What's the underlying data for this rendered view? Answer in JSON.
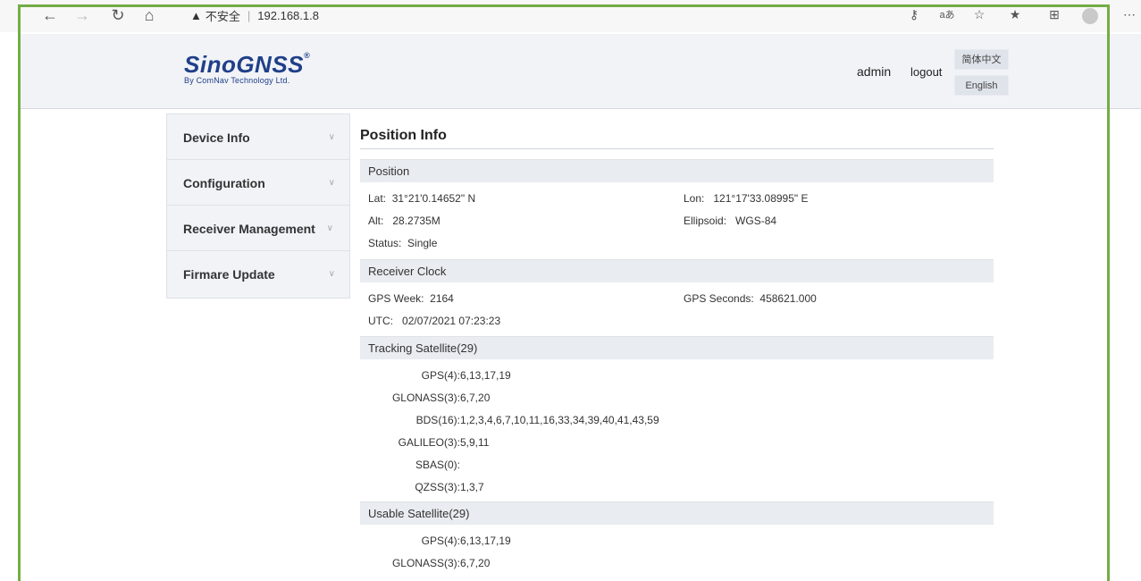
{
  "browser": {
    "security_label": "不安全",
    "url": "192.168.1.8"
  },
  "header": {
    "brand": "SinoGNSS",
    "brand_mark": "®",
    "brand_sub": "By ComNav Technology Ltd.",
    "user": "admin",
    "logout": "logout",
    "lang_cn": "简体中文",
    "lang_en": "English"
  },
  "sidebar": {
    "items": [
      {
        "label": "Device Info"
      },
      {
        "label": "Configuration"
      },
      {
        "label": "Receiver Management"
      },
      {
        "label": "Firmare Update"
      }
    ]
  },
  "main": {
    "title": "Position Info",
    "position": {
      "header": "Position",
      "lat_label": "Lat:",
      "lat_value": "31°21'0.14652\" N",
      "lon_label": "Lon:",
      "lon_value": "121°17'33.08995\" E",
      "alt_label": "Alt:",
      "alt_value": "28.2735M",
      "ellipsoid_label": "Ellipsoid:",
      "ellipsoid_value": "WGS-84",
      "status_label": "Status:",
      "status_value": "Single"
    },
    "clock": {
      "header": "Receiver Clock",
      "week_label": "GPS Week:",
      "week_value": "2164",
      "seconds_label": "GPS Seconds:",
      "seconds_value": "458621.000",
      "utc_label": "UTC:",
      "utc_value": "02/07/2021 07:23:23"
    },
    "tracking": {
      "header": "Tracking Satellite(29)",
      "rows": [
        {
          "label": "GPS(4):",
          "value": "6,13,17,19"
        },
        {
          "label": "GLONASS(3):",
          "value": "6,7,20"
        },
        {
          "label": "BDS(16):",
          "value": "1,2,3,4,6,7,10,11,16,33,34,39,40,41,43,59"
        },
        {
          "label": "GALILEO(3):",
          "value": "5,9,11"
        },
        {
          "label": "SBAS(0):",
          "value": ""
        },
        {
          "label": "QZSS(3):",
          "value": "1,3,7"
        }
      ]
    },
    "usable": {
      "header": "Usable Satellite(29)",
      "rows": [
        {
          "label": "GPS(4):",
          "value": "6,13,17,19"
        },
        {
          "label": "GLONASS(3):",
          "value": "6,7,20"
        }
      ]
    }
  }
}
